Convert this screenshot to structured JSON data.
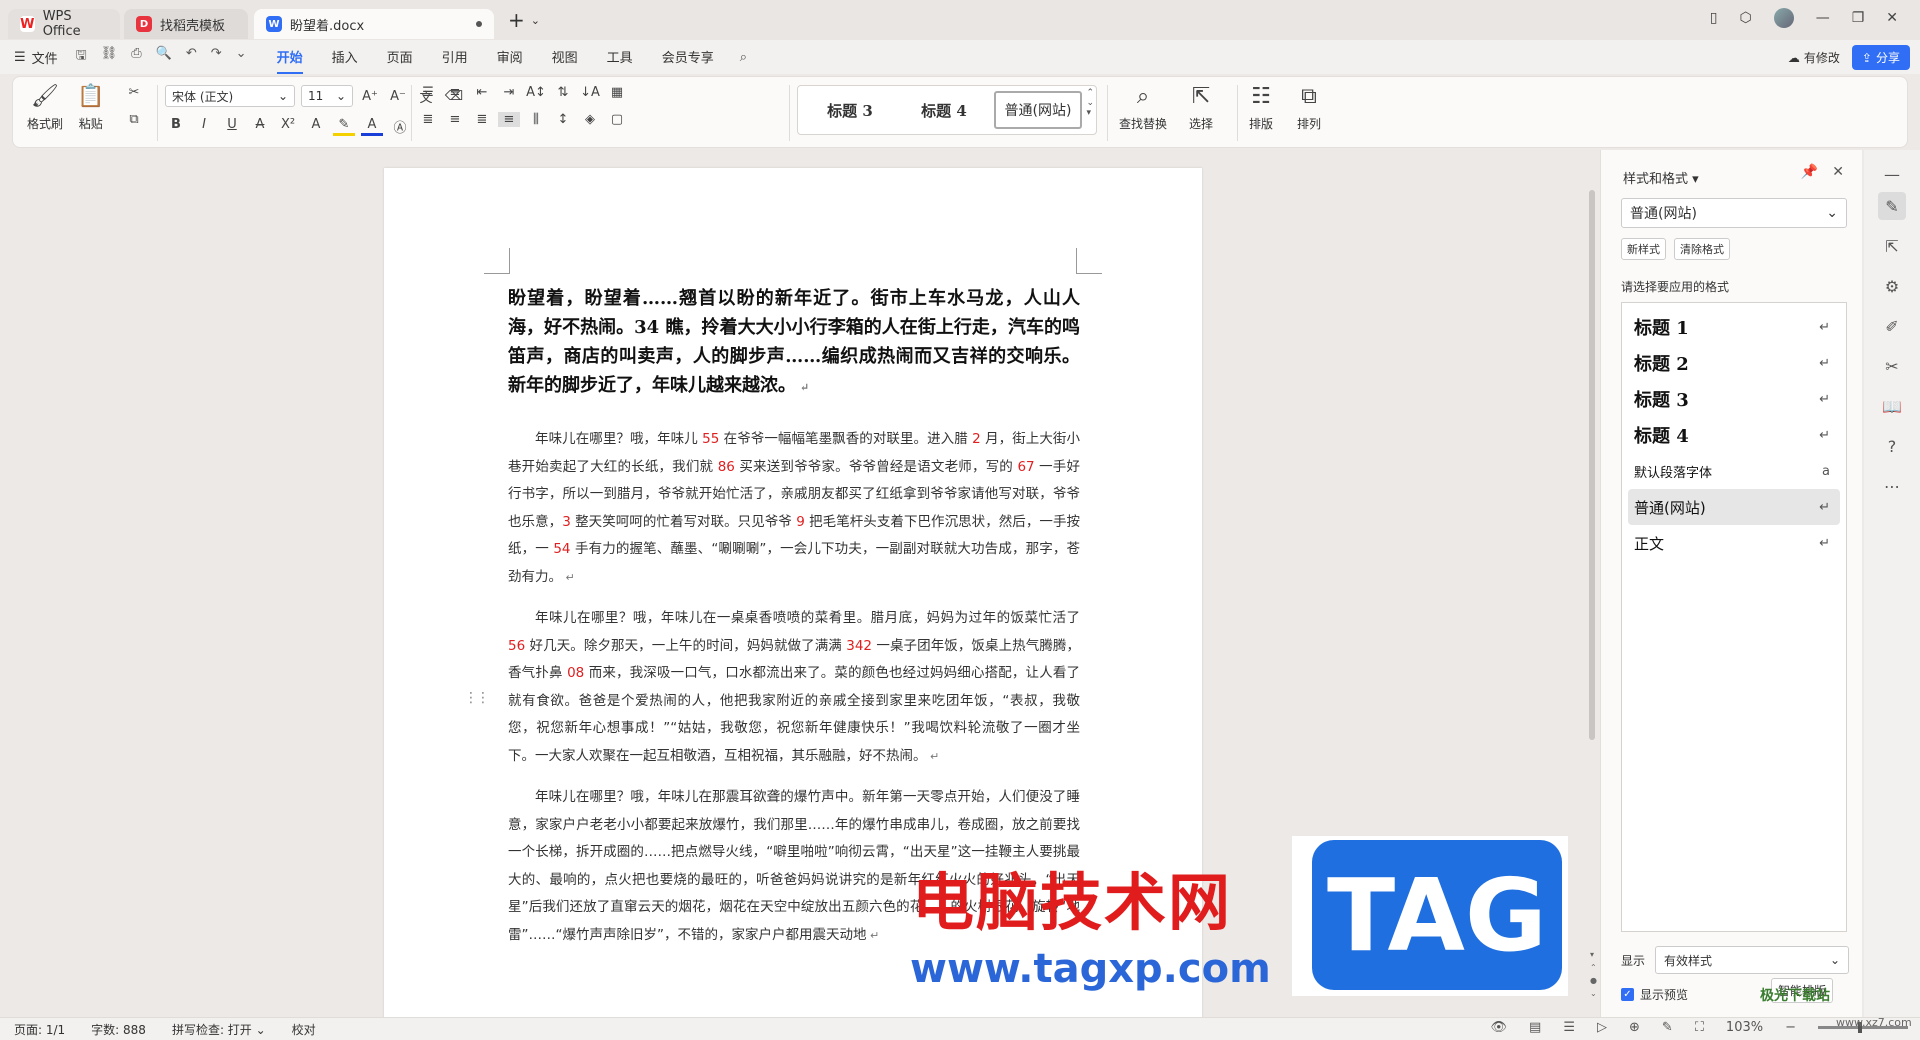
{
  "tabs": [
    {
      "label": "WPS Office",
      "icon": "wps-logo-icon"
    },
    {
      "label": "找稻壳模板",
      "icon": "docer-icon"
    },
    {
      "label": "盼望着.docx",
      "icon": "word-doc-icon"
    }
  ],
  "menu": {
    "file": "文件",
    "tabs": [
      "开始",
      "插入",
      "页面",
      "引用",
      "审阅",
      "视图",
      "工具",
      "会员专享"
    ],
    "active_tab": "开始",
    "modified": "有修改",
    "share": "分享"
  },
  "ribbon": {
    "format_painter": "格式刷",
    "paste": "粘贴",
    "font_name": "宋体 (正文)",
    "font_size": "11",
    "gallery": [
      "标题 3",
      "标题 4",
      "普通(网站)"
    ],
    "find_replace": "查找替换",
    "select": "选择",
    "layout": "排版",
    "arrange": "排列"
  },
  "document": {
    "heading": "盼望着，盼望着……翘首以盼的新年近了。街市上车水马龙，人山人海，好不热闹。34 瞧，拎着大大小小行李箱的人在街上行走，汽车的鸣笛声，商店的叫卖声，人的脚步声……编织成热闹而又吉祥的交响乐。新年的脚步近了，年味儿越来越浓。",
    "p1": [
      {
        "t": "年味儿在哪里？哦，年味儿 "
      },
      {
        "n": "55"
      },
      {
        "t": " 在爷爷一幅幅笔墨飘香的对联里。进入腊 "
      },
      {
        "n": "2"
      },
      {
        "t": " 月，街上大街小巷开始卖起了大红的长纸，我们就 "
      },
      {
        "n": "86"
      },
      {
        "t": " 买来送到爷爷家。爷爷曾经是语文老师，写的 "
      },
      {
        "n": "67"
      },
      {
        "t": " 一手好行书字，所以一到腊月，爷爷就开始忙活了，亲戚朋友都买了红纸拿到爷爷家请他写对联，爷爷也乐意，"
      },
      {
        "n": "3"
      },
      {
        "t": " 整天笑呵呵的忙着写对联。只见爷爷 "
      },
      {
        "n": "9"
      },
      {
        "t": " 把毛笔杆头支着下巴作沉思状，然后，一手按纸，一 "
      },
      {
        "n": "54"
      },
      {
        "t": " 手有力的握笔、蘸墨、“唰唰唰”，一会儿下功夫，一副副对联就大功告成，那字，苍劲有力。"
      }
    ],
    "p2": [
      {
        "t": "年味儿在哪里？哦，年味儿在一桌桌香喷喷的菜肴里。腊月底，妈妈为过年的饭菜忙活了 "
      },
      {
        "n": "56"
      },
      {
        "t": " 好几天。除夕那天，一上午的时间，妈妈就做了满满 "
      },
      {
        "n": "342"
      },
      {
        "t": " 一桌子团年饭，饭桌上热气腾腾，香气扑鼻 "
      },
      {
        "n": "08"
      },
      {
        "t": " 而来，我深吸一口气，口水都流出来了。菜的颜色也经过妈妈细心搭配，让人看了就有食欲。爸爸是个爱热闹的人，他把我家附近的亲戚全接到家里来吃团年饭，“表叔，我敬您，祝您新年心想事成！”“姑姑，我敬您，祝您新年健康快乐！”我喝饮料轮流敬了一圈才坐下。一大家人欢聚在一起互相敬酒，互相祝福，其乐融融，好不热闹。"
      }
    ],
    "p3": [
      {
        "t": "年味儿在哪里？哦，年味儿在那震耳欲聋的爆竹声中。新年第一天零点开始，人们便没了睡意，家家户户老老小小都要起来放爆竹，我们那里……年的爆竹串成串儿，卷成圈，放之前要找一个长梯，拆开成圈的……把点燃导火线，“噼里啪啦”响彻云霄，“出天星”这一挂鞭主人要挑最大的、最响的，点火把也要烧的最旺的，听爸爸妈妈说讲究的是新年红红火火的好兆头。“出天星”后我们还放了直窜云天的烟花，烟花在天空中绽放出五颜六色的花……的火树银花、旋转“地雷”……“爆竹声声除旧岁”，不错的，家家户户都用震天动地"
      }
    ]
  },
  "panel": {
    "title": "样式和格式",
    "current_style": "普通(网站)",
    "new_style": "新样式",
    "clear_format": "清除格式",
    "prompt": "请选择要应用的格式",
    "styles": [
      {
        "name": "标题 1",
        "mark": "↵",
        "kind": "h"
      },
      {
        "name": "标题 2",
        "mark": "↵",
        "kind": "h"
      },
      {
        "name": "标题 3",
        "mark": "↵",
        "kind": "h"
      },
      {
        "name": "标题 4",
        "mark": "↵",
        "kind": "h"
      },
      {
        "name": "默认段落字体",
        "mark": "a",
        "kind": "sm"
      },
      {
        "name": "普通(网站)",
        "mark": "↵",
        "kind": "md",
        "active": true
      },
      {
        "name": "正文",
        "mark": "↵",
        "kind": "md"
      }
    ],
    "show_label": "显示",
    "show_value": "有效样式",
    "preview_label": "显示预览",
    "smart_layout": "智能排版"
  },
  "status": {
    "page": "页面: 1/1",
    "words": "字数: 888",
    "spell": "拼写检查: 打开",
    "proof": "校对",
    "zoom": "103%"
  },
  "watermark": {
    "cn": "电脑技术网",
    "url": "www.tagxp.com",
    "tag": "TAG",
    "site": "极光下载站",
    "site_url": "www.xz7.com"
  }
}
